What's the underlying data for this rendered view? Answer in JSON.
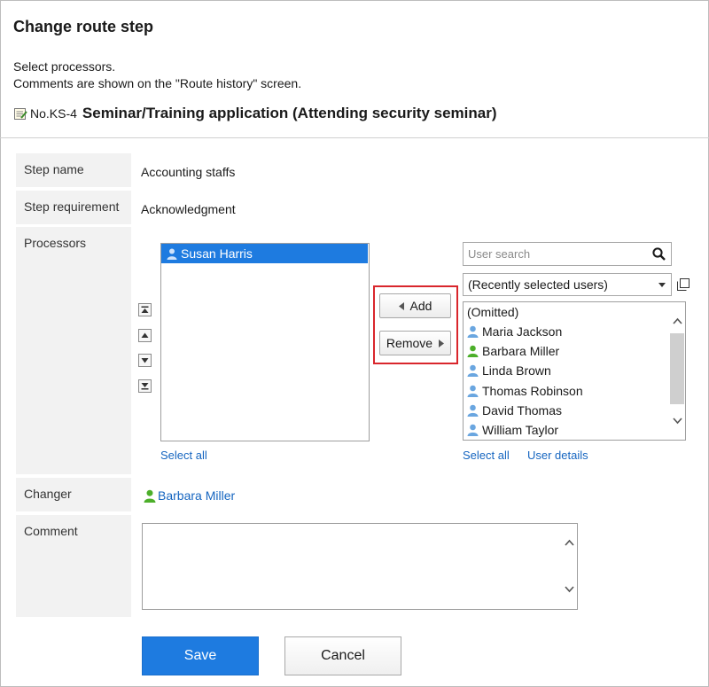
{
  "page": {
    "title": "Change route step",
    "instructions": [
      "Select processors.",
      "Comments are shown on the \"Route history\" screen."
    ]
  },
  "application": {
    "number": "No.KS-4",
    "title": "Seminar/Training application (Attending security seminar)"
  },
  "form": {
    "step_name_label": "Step name",
    "step_name_value": "Accounting staffs",
    "step_requirement_label": "Step requirement",
    "step_requirement_value": "Acknowledgment",
    "processors_label": "Processors",
    "changer_label": "Changer",
    "changer_value": "Barbara Miller",
    "comment_label": "Comment"
  },
  "processors": {
    "selected": [
      "Susan Harris"
    ],
    "select_all_label": "Select all"
  },
  "transfer": {
    "add_label": "Add",
    "remove_label": "Remove"
  },
  "candidates": {
    "search_placeholder": "User search",
    "group_selected": "(Recently selected users)",
    "items": [
      {
        "name": "(Omitted)",
        "icon": "none"
      },
      {
        "name": "Maria Jackson",
        "icon": "user-blue"
      },
      {
        "name": "Barbara Miller",
        "icon": "user-green"
      },
      {
        "name": "Linda Brown",
        "icon": "user-blue"
      },
      {
        "name": "Thomas Robinson",
        "icon": "user-blue"
      },
      {
        "name": "David Thomas",
        "icon": "user-blue"
      },
      {
        "name": "William Taylor",
        "icon": "user-blue"
      }
    ],
    "select_all_label": "Select all",
    "user_details_label": "User details"
  },
  "actions": {
    "save_label": "Save",
    "cancel_label": "Cancel"
  },
  "colors": {
    "accent": "#1e7be0",
    "highlight": "#d9262c",
    "link": "#1565c0",
    "user_blue": "#6aa6e0",
    "user_green": "#4caf2a"
  }
}
